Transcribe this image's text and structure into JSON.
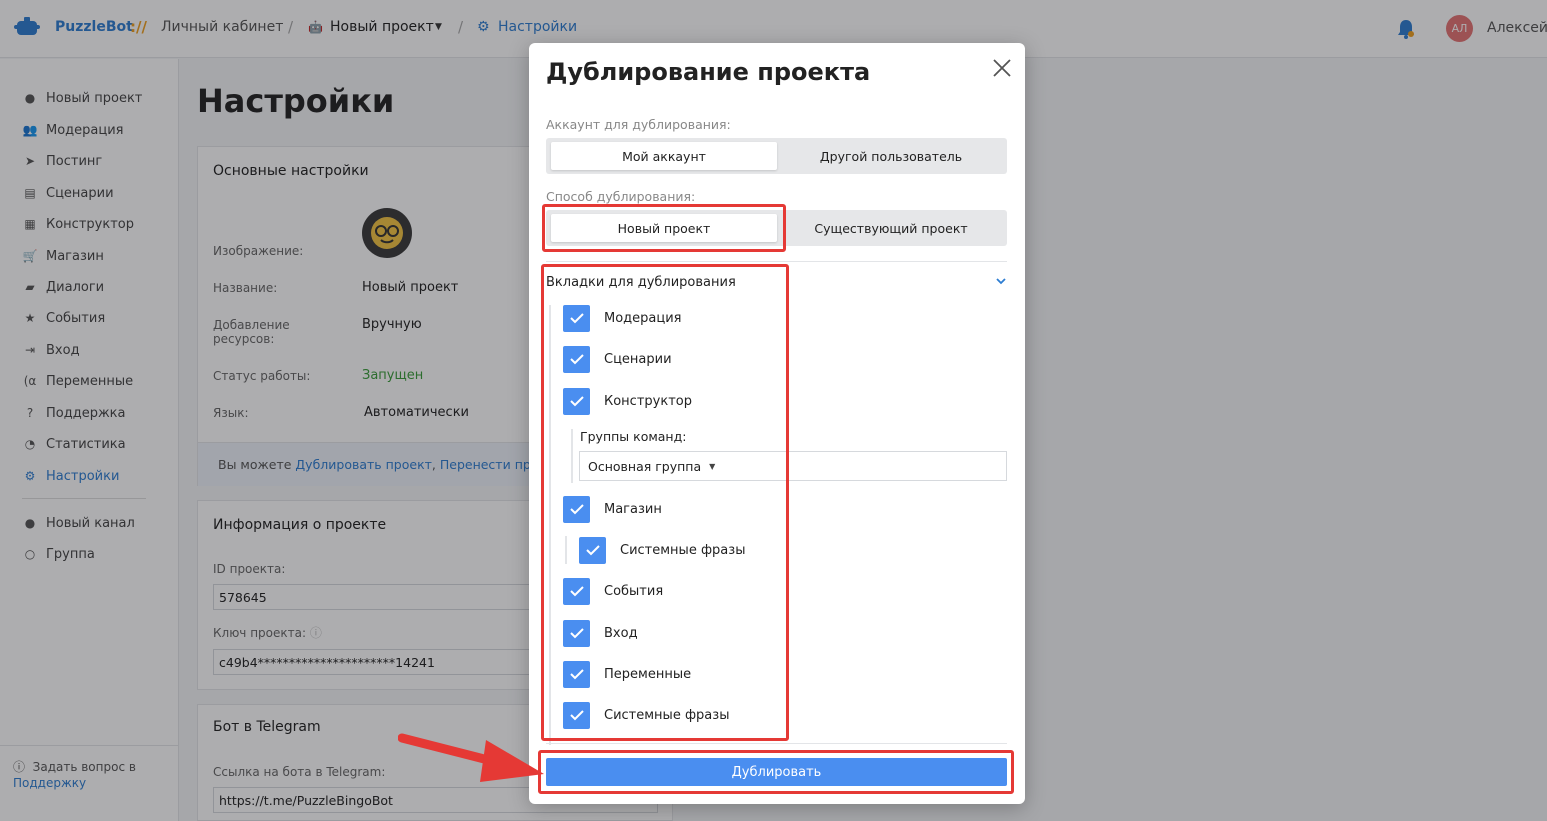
{
  "header": {
    "brand": "PuzzleBot",
    "brand_slash": "://",
    "crumbs": [
      "Личный кабинет",
      "Новый проект",
      "Настройки"
    ],
    "user_initials": "АЛ",
    "user_name": "Алексей"
  },
  "sidebar": {
    "items": [
      {
        "label": "Новый проект",
        "icon": "bot-icon"
      },
      {
        "label": "Модерация",
        "icon": "users-icon"
      },
      {
        "label": "Постинг",
        "icon": "paper-plane-icon"
      },
      {
        "label": "Сценарии",
        "icon": "scenarios-icon"
      },
      {
        "label": "Конструктор",
        "icon": "grid-icon"
      },
      {
        "label": "Магазин",
        "icon": "cart-icon"
      },
      {
        "label": "Диалоги",
        "icon": "chat-icon"
      },
      {
        "label": "События",
        "icon": "star-icon"
      },
      {
        "label": "Вход",
        "icon": "sign-in-icon"
      },
      {
        "label": "Переменные",
        "icon": "variable-icon"
      },
      {
        "label": "Поддержка",
        "icon": "question-icon"
      },
      {
        "label": "Статистика",
        "icon": "pie-chart-icon"
      },
      {
        "label": "Настройки",
        "icon": "gear-icon",
        "active": true
      }
    ],
    "channels": [
      {
        "label": "Новый канал",
        "icon": "channel-icon"
      },
      {
        "label": "Группа",
        "icon": "group-icon"
      }
    ],
    "help_text": "Задать вопрос в",
    "help_link": "Поддержку"
  },
  "main": {
    "title": "Настройки",
    "basic": {
      "title": "Основные настройки",
      "image_label": "Изображение:",
      "name_label": "Название:",
      "name_value": "Новый проект",
      "resources_label": "Добавление ресурсов:",
      "resources_value": "Вручную",
      "status_label": "Статус работы:",
      "status_value": "Запущен",
      "lang_label": "Язык:",
      "lang_value": "Автоматически",
      "info_prefix": "Вы можете ",
      "info_link1": "Дублировать проект",
      "info_sep": ", ",
      "info_link2": "Перенести проект"
    },
    "project_info": {
      "title": "Информация о проекте",
      "id_label": "ID проекта:",
      "id_value": "578645",
      "key_label": "Ключ проекта:",
      "key_value": "c49b4**********************14241"
    },
    "telegram": {
      "title": "Бот в Telegram",
      "link_label": "Ссылка на бота в Telegram:",
      "link_value": "https://t.me/PuzzleBingoBot"
    }
  },
  "modal": {
    "title": "Дублирование проекта",
    "account_label": "Аккаунт для дублирования:",
    "account_options": [
      "Мой аккаунт",
      "Другой пользователь"
    ],
    "account_selected": "Мой аккаунт",
    "method_label": "Способ дублирования:",
    "method_options": [
      "Новый проект",
      "Существующий проект"
    ],
    "method_selected": "Новый проект",
    "tabs_label": "Вкладки для дублирования",
    "tabs": [
      {
        "label": "Модерация",
        "checked": true
      },
      {
        "label": "Сценарии",
        "checked": true
      },
      {
        "label": "Конструктор",
        "checked": true
      },
      {
        "label": "Магазин",
        "checked": true
      },
      {
        "label": "Системные фразы",
        "checked": true,
        "nested": true
      },
      {
        "label": "События",
        "checked": true
      },
      {
        "label": "Вход",
        "checked": true
      },
      {
        "label": "Переменные",
        "checked": true
      },
      {
        "label": "Системные фразы",
        "checked": true
      }
    ],
    "command_groups_label": "Группы команд:",
    "command_groups_value": "Основная группа",
    "submit_label": "Дублировать"
  },
  "colors": {
    "accent": "#4a8ef0",
    "link": "#2d7dd2",
    "annotation": "#e53935",
    "status_ok": "#3a9d3a"
  }
}
